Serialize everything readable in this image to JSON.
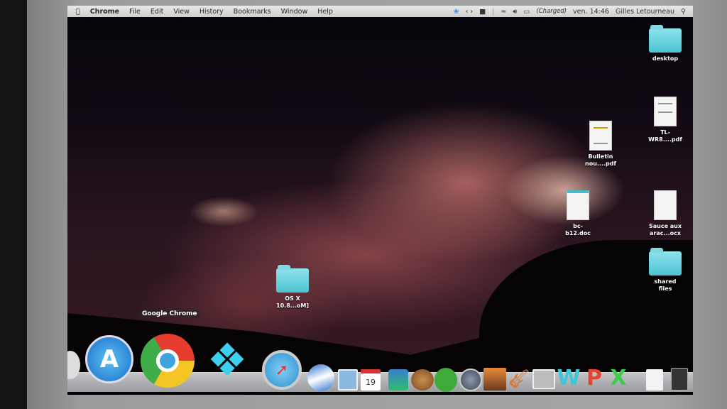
{
  "menubar": {
    "apple_icon": "apple-logo",
    "app": "Chrome",
    "menus": [
      "File",
      "Edit",
      "View",
      "History",
      "Bookmarks",
      "Window",
      "Help"
    ],
    "status": {
      "battery": "(Charged)",
      "clock": "ven. 14:46",
      "user": "Gilles Letourneau"
    }
  },
  "desktop_icons": [
    {
      "label1": "desktop",
      "label2": "",
      "kind": "folder"
    },
    {
      "label1": "TL-",
      "label2": "WR8....pdf",
      "kind": "pdf"
    },
    {
      "label1": "Bulletin",
      "label2": "nou....pdf",
      "kind": "pdf"
    },
    {
      "label1": "bc-",
      "label2": "b12.doc",
      "kind": "doc"
    },
    {
      "label1": "Sauce aux",
      "label2": "arac...ocx",
      "kind": "doc"
    },
    {
      "label1": "shared",
      "label2": "files",
      "kind": "folder"
    },
    {
      "label1": "OS X",
      "label2": "10.8...oM]",
      "kind": "folder"
    }
  ],
  "dock": {
    "tooltip": "Google Chrome",
    "calendar_day": "19",
    "items": [
      "finder-partial",
      "app-store",
      "google-chrome",
      "dropbox",
      "safari",
      "google-earth",
      "preview",
      "calendar",
      "angry-birds-space",
      "fruit-juice",
      "parrot",
      "time-machine",
      "iphoto",
      "garageband",
      "screenshot",
      "word-w",
      "powerpoint-p",
      "excel-x",
      "document",
      "stack"
    ]
  }
}
